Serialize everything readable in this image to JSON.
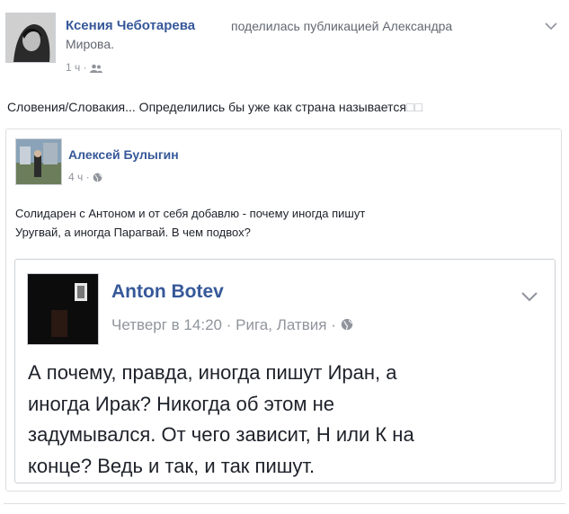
{
  "post": {
    "author": "Ксения Чеботарева",
    "action_line1": "поделилась публикацией Александра",
    "action_line2": "Мирова.",
    "time": "1 ч",
    "text": "Словения/Словакия... Определились бы уже как страна называется",
    "trailing_glyphs": "□□",
    "chevron_icon": "chevron-down-icon",
    "privacy_icon": "friends-icon"
  },
  "shared": {
    "author": "Алексей Булыгин",
    "time": "4 ч",
    "privacy_icon": "globe-icon",
    "text_line1": "Солидарен с Антоном и от себя добавлю - почему иногда пишут",
    "text_line2": "Уругвай, а иногда Парагвай. В чем подвох?"
  },
  "inner": {
    "author": "Anton Botev",
    "time": "Четверг в 14:20",
    "location": "Рига, Латвия",
    "separator": "·",
    "privacy_icon": "globe-icon",
    "chevron_icon": "chevron-down-icon",
    "text_line1": "А почему, правда, иногда пишут Иран, а",
    "text_line2": "иногда Ирак? Никогда об этом не",
    "text_line3": "задумывался. От чего зависит, Н или К на",
    "text_line4": "конце? Ведь и так, и так пишут."
  },
  "colors": {
    "link": "#365899",
    "meta": "#90949c",
    "text": "#1d2129",
    "border": "#dddfe2"
  }
}
